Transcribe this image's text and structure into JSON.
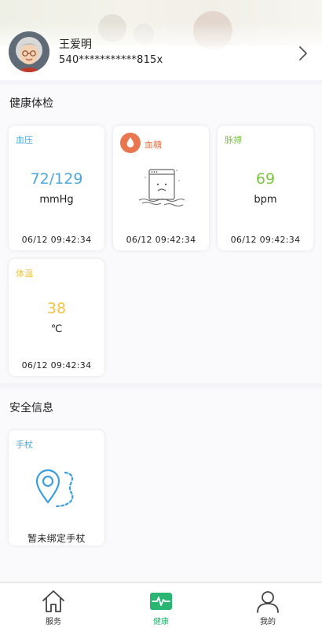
{
  "user": {
    "name": "王爱明",
    "id_masked": "540***********815x"
  },
  "health": {
    "section_title": "健康体检",
    "cards": [
      {
        "label": "血压",
        "value": "72/129",
        "unit": "mmHg",
        "time": "06/12 09:42:34",
        "color": "#4aa8df"
      },
      {
        "label": "血糖",
        "value": "",
        "unit": "",
        "time": "06/12 09:42:34",
        "color": "#e8764f",
        "icon": "water-drop-icon",
        "empty_state_icon": "sad-box-icon"
      },
      {
        "label": "脉搏",
        "value": "69",
        "unit": "bpm",
        "time": "06/12 09:42:34",
        "color": "#7cc640"
      },
      {
        "label": "体温",
        "value": "38",
        "unit": "℃",
        "time": "06/12 09:42:34",
        "color": "#f2c340"
      }
    ]
  },
  "safety": {
    "section_title": "安全信息",
    "cards": [
      {
        "label": "手杖",
        "status": "暂未绑定手杖",
        "color": "#4aa8df",
        "icon": "location-route-icon"
      }
    ]
  },
  "tabbar": {
    "active_color": "#2bb573",
    "items": [
      {
        "label": "服务",
        "icon": "home-icon",
        "active": false
      },
      {
        "label": "健康",
        "icon": "health-monitor-icon",
        "active": true
      },
      {
        "label": "我的",
        "icon": "person-icon",
        "active": false
      }
    ]
  }
}
